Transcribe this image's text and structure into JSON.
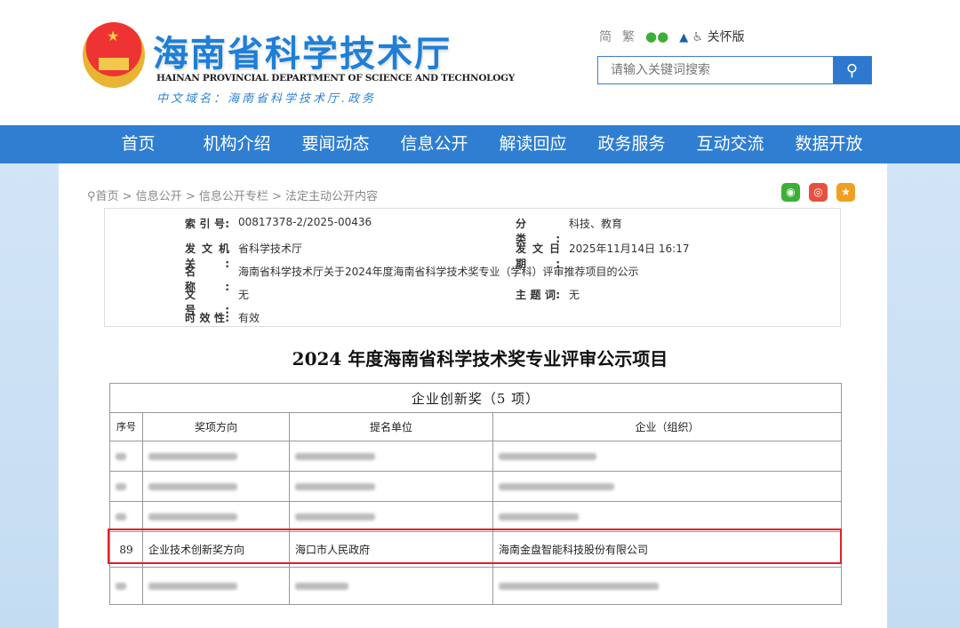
{
  "header": {
    "title": "海南省科学技术厅",
    "title_en": "HAINAN PROVINCIAL DEPARTMENT OF SCIENCE AND TECHNOLOGY",
    "domain": "中文域名：海南省科学技术厅.政务",
    "simplified": "简",
    "traditional": "繁",
    "care_mode": "关怀版",
    "search_placeholder": "请输入关键词搜索"
  },
  "nav": [
    "首页",
    "机构介绍",
    "要闻动态",
    "信息公开",
    "解读回应",
    "政务服务",
    "互动交流",
    "数据开放"
  ],
  "breadcrumb": "首页 > 信息公开 > 信息公开专栏 > 法定主动公开内容",
  "meta": {
    "index_label": "索 引 号:",
    "index": "00817378-2/2025-00436",
    "category_label": "分　　类:",
    "category": "科技、教育",
    "issuer_label": "发文机关:",
    "issuer": "省科学技术厅",
    "date_label": "发文日期:",
    "date": "2025年11月14日 16:17",
    "name_label": "名　　称:",
    "name": "海南省科学技术厅关于2024年度海南省科学技术奖专业（学科）评审推荐项目的公示",
    "docno_label": "文　　号:",
    "docno": "无",
    "topic_label": "主 题 词:",
    "topic": "无",
    "validity_label": "时 效 性:",
    "validity": "有效"
  },
  "doc_title": "2024 年度海南省科学技术奖专业评审公示项目",
  "table": {
    "caption": "企业创新奖（5 项）",
    "headers": [
      "序号",
      "奖项方向",
      "提名单位",
      "企业（组织）"
    ],
    "highlight_row": [
      "89",
      "企业技术创新奖方向",
      "海口市人民政府",
      "海南金盘智能科技股份有限公司"
    ]
  },
  "colors": {
    "nav": "#2f7ed2",
    "highlight": "#e0202a"
  }
}
